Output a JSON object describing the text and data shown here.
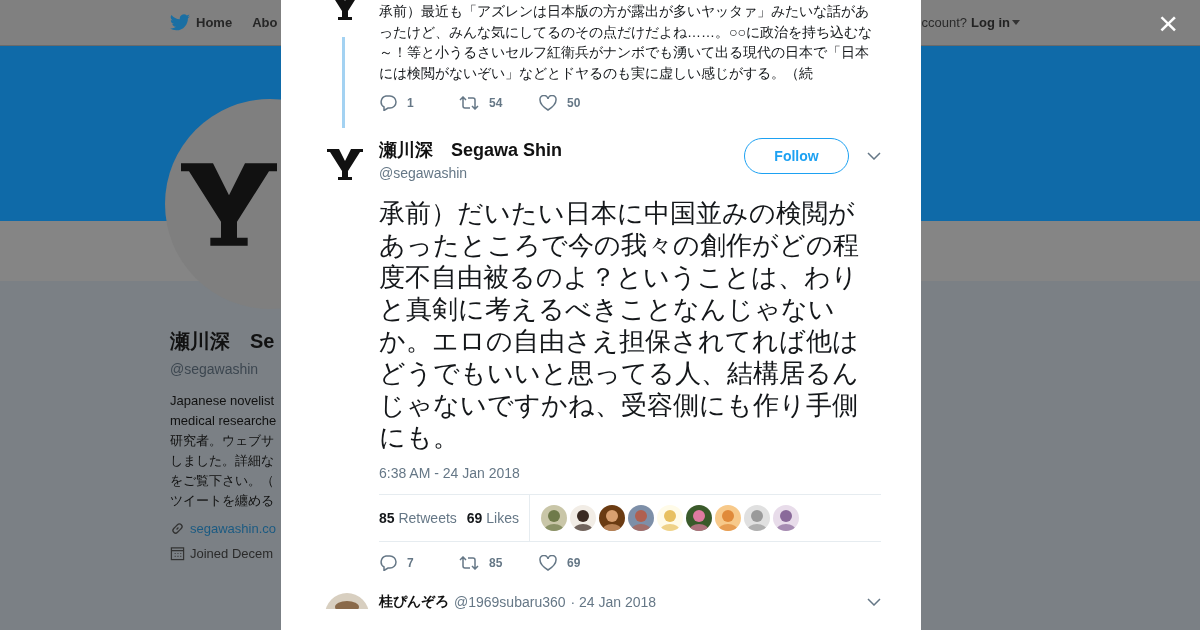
{
  "background_page": {
    "nav": {
      "items": [
        "Home",
        "Abo"
      ],
      "account_prompt": "ccount?",
      "login": "Log in"
    },
    "profile": {
      "name": "瀬川深　Se",
      "handle": "@segawashin",
      "bio_lines": [
        "Japanese novelist",
        "medical researche",
        "研究者。ウェブサ",
        "しました。詳細な",
        "をご覧下さい。（",
        "ツイートを纏める"
      ],
      "link": "segawashin.co",
      "joined": "Joined Decem"
    }
  },
  "modal": {
    "close": "×",
    "previous_tweet": {
      "text": "承前）最近も「アズレンは日本版の方が露出が多いヤッタァ」みたいな話があったけど、みんな気にしてるのその点だけだよね……。○○に政治を持ち込むな～！等と小うるさいセルフ紅衛兵がナンボでも湧いて出る現代の日本で「日本には検閲がないぞい」などとドヤるのも実に虚しい感じがする。（続",
      "replies": "1",
      "retweets": "54",
      "likes": "50"
    },
    "tweet": {
      "name": "瀬川深　Segawa Shin",
      "handle": "@segawashin",
      "follow": "Follow",
      "text": "承前）だいたい日本に中国並みの検閲があったところで今の我々の創作がどの程度不自由被るのよ？ということは、わりと真剣に考えるべきことなんじゃないか。エロの自由さえ担保されてれば他はどうでもいいと思ってる人、結構居るんじゃないですかね、受容側にも作り手側にも。",
      "time": "6:38 AM - 24 Jan 2018",
      "stats": [
        {
          "count": "85",
          "label": "Retweets"
        },
        {
          "count": "69",
          "label": "Likes"
        }
      ],
      "replies": "7",
      "retweets": "85",
      "likes": "69"
    },
    "next_tweet": {
      "name": "桂ぴんぞろ",
      "handle": "@1969subaru360",
      "date": "· 24 Jan 2018"
    }
  }
}
